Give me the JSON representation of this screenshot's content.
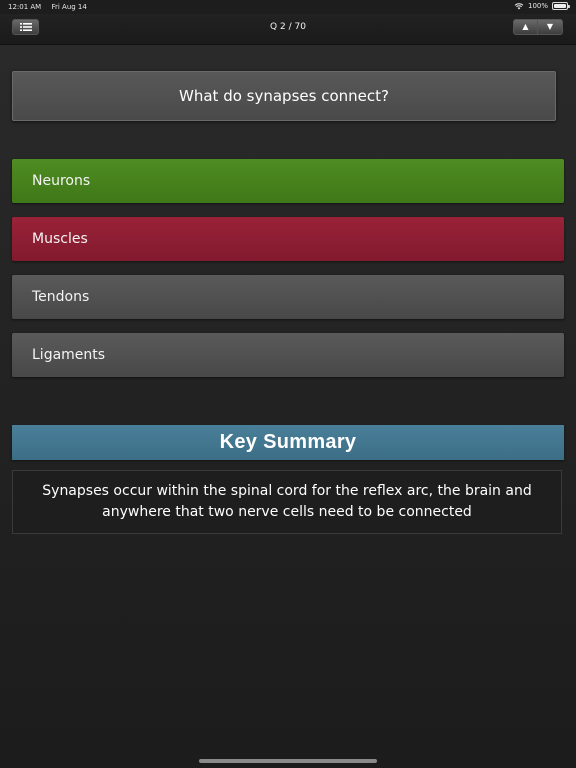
{
  "status": {
    "time": "12:01 AM",
    "date": "Fri Aug 14",
    "battery": "100%",
    "icons": [
      "wifi-icon",
      "battery-icon"
    ]
  },
  "nav": {
    "title": "Q 2 / 70",
    "menu_icon": "list-icon",
    "prev_arrow": "▲",
    "next_arrow": "▼"
  },
  "question": {
    "text": "What do synapses connect?"
  },
  "options": [
    {
      "label": "Neurons",
      "state": "correct"
    },
    {
      "label": "Muscles",
      "state": "wrong"
    },
    {
      "label": "Tendons",
      "state": "neutral"
    },
    {
      "label": "Ligaments",
      "state": "neutral"
    }
  ],
  "summary": {
    "title": "Key Summary",
    "text": "Synapses occur within the spinal cord for the reflex arc, the brain and anywhere that two nerve cells need to be connected"
  },
  "colors": {
    "correct": "#4a8520",
    "wrong": "#8f1e34",
    "neutral": "#505050",
    "summary_header": "#437790"
  }
}
